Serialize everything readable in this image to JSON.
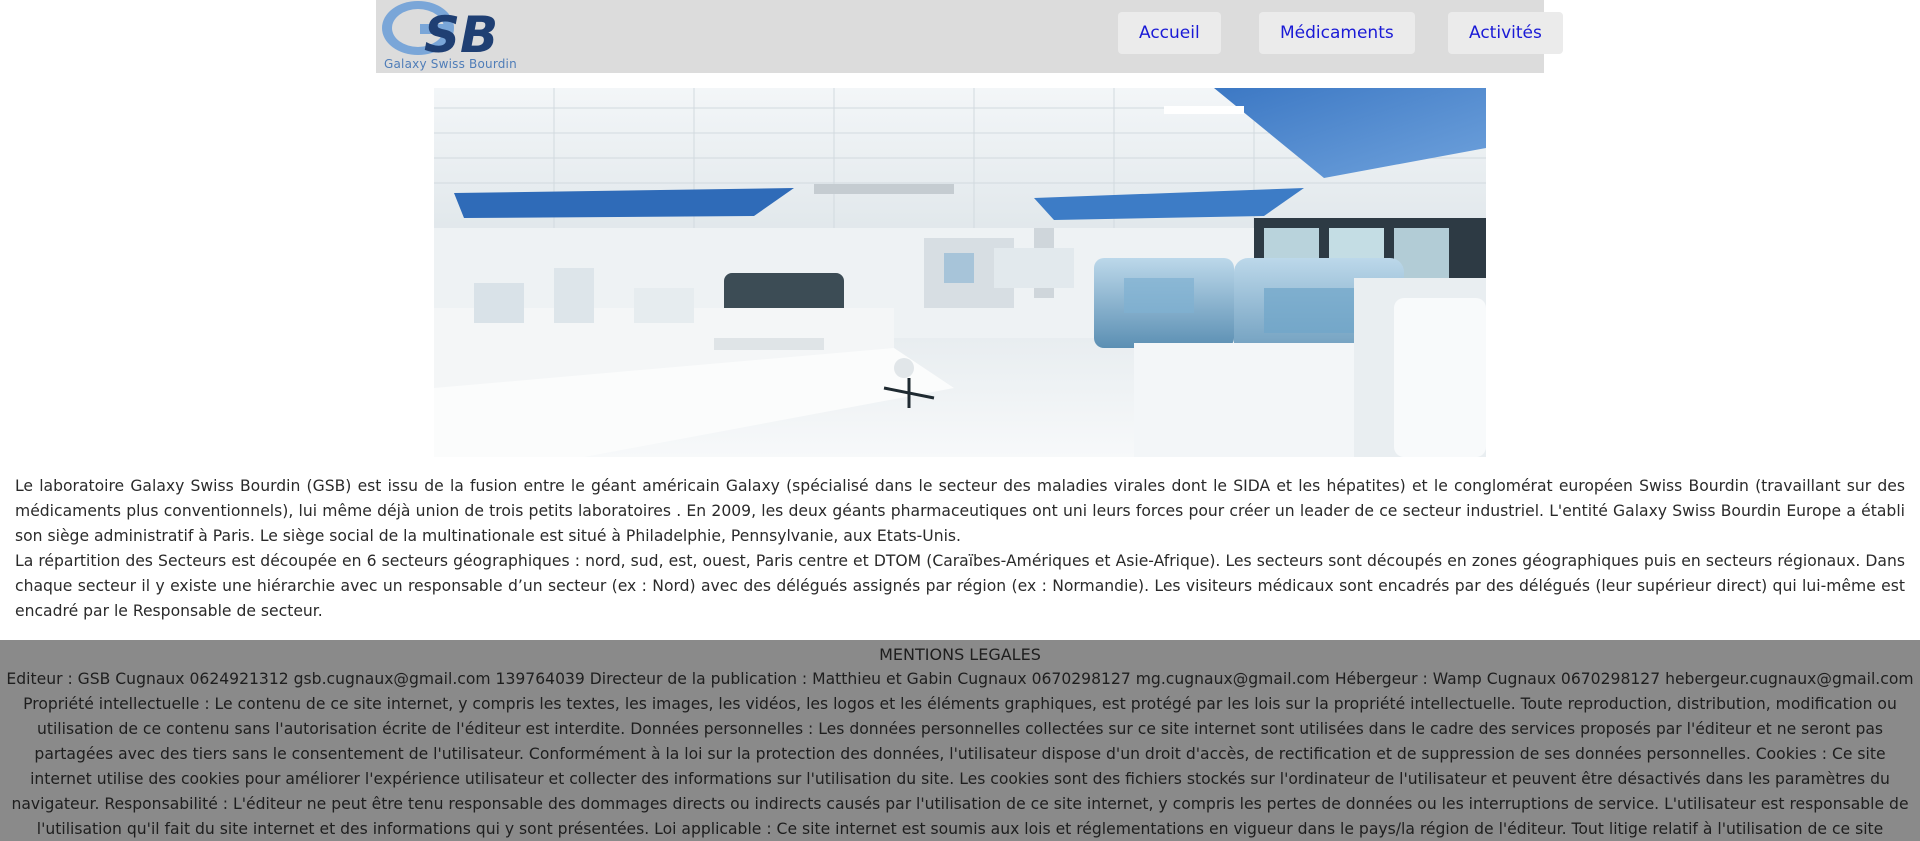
{
  "header": {
    "logo": {
      "text": "GSB",
      "caption": "Galaxy Swiss Bourdin"
    },
    "nav": [
      {
        "label": "Accueil"
      },
      {
        "label": "Médicaments"
      },
      {
        "label": "Activités"
      }
    ],
    "colors": {
      "background": "#dcdcdc",
      "nav_text": "#1a1ad6",
      "logo_dark": "#1f3f73",
      "logo_light": "#7aa6d8"
    }
  },
  "hero": {
    "icon": "laboratory-photo"
  },
  "intro": {
    "paragraph1": "Le laboratoire Galaxy Swiss Bourdin (GSB) est issu de la fusion entre le géant américain Galaxy (spécialisé dans le secteur des maladies virales dont le SIDA et les hépatites) et le conglomérat européen Swiss Bourdin (travaillant sur des médicaments plus conventionnels), lui même déjà union de trois petits laboratoires . En 2009, les deux géants pharmaceutiques ont uni leurs forces pour créer un leader de ce secteur industriel. L'entité Galaxy Swiss Bourdin Europe a établi son siège administratif à Paris. Le siège social de la multinationale est situé à Philadelphie, Pennsylvanie, aux Etats-Unis.",
    "paragraph2": "La répartition des Secteurs est découpée en 6 secteurs géographiques : nord, sud, est, ouest, Paris centre et DTOM (Caraïbes-Amériques et Asie-Afrique). Les secteurs sont découpés en zones géographiques puis en secteurs régionaux. Dans chaque secteur il y existe une hiérarchie avec un responsable d’un secteur (ex : Nord) avec des délégués assignés par région (ex : Normandie). Les visiteurs médicaux sont encadrés par des délégués (leur supérieur direct) qui lui-même est encadré par le Responsable de secteur."
  },
  "footer": {
    "title": "MENTIONS LEGALES",
    "text": "Editeur : GSB Cugnaux 0624921312 gsb.cugnaux@gmail.com 139764039 Directeur de la publication : Matthieu et Gabin Cugnaux 0670298127 mg.cugnaux@gmail.com Hébergeur : Wamp Cugnaux 0670298127 hebergeur.cugnaux@gmail.com Propriété intellectuelle : Le contenu de ce site internet, y compris les textes, les images, les vidéos, les logos et les éléments graphiques, est protégé par les lois sur la propriété intellectuelle. Toute reproduction, distribution, modification ou utilisation de ce contenu sans l'autorisation écrite de l'éditeur est interdite. Données personnelles : Les données personnelles collectées sur ce site internet sont utilisées dans le cadre des services proposés par l'éditeur et ne seront pas partagées avec des tiers sans le consentement de l'utilisateur. Conformément à la loi sur la protection des données, l'utilisateur dispose d'un droit d'accès, de rectification et de suppression de ses données personnelles. Cookies : Ce site internet utilise des cookies pour améliorer l'expérience utilisateur et collecter des informations sur l'utilisation du site. Les cookies sont des fichiers stockés sur l'ordinateur de l'utilisateur et peuvent être désactivés dans les paramètres du navigateur. Responsabilité : L'éditeur ne peut être tenu responsable des dommages directs ou indirects causés par l'utilisation de ce site internet, y compris les pertes de données ou les interruptions de service. L'utilisateur est responsable de l'utilisation qu'il fait du site internet et des informations qui y sont présentées. Loi applicable : Ce site internet est soumis aux lois et réglementations en vigueur dans le pays/la région de l'éditeur. Tout litige relatif à l'utilisation de ce site internet sera soumis à la juridiction compétente dans le pays/la région de l'éditeur.",
    "colors": {
      "background": "#8a8a8a"
    }
  }
}
